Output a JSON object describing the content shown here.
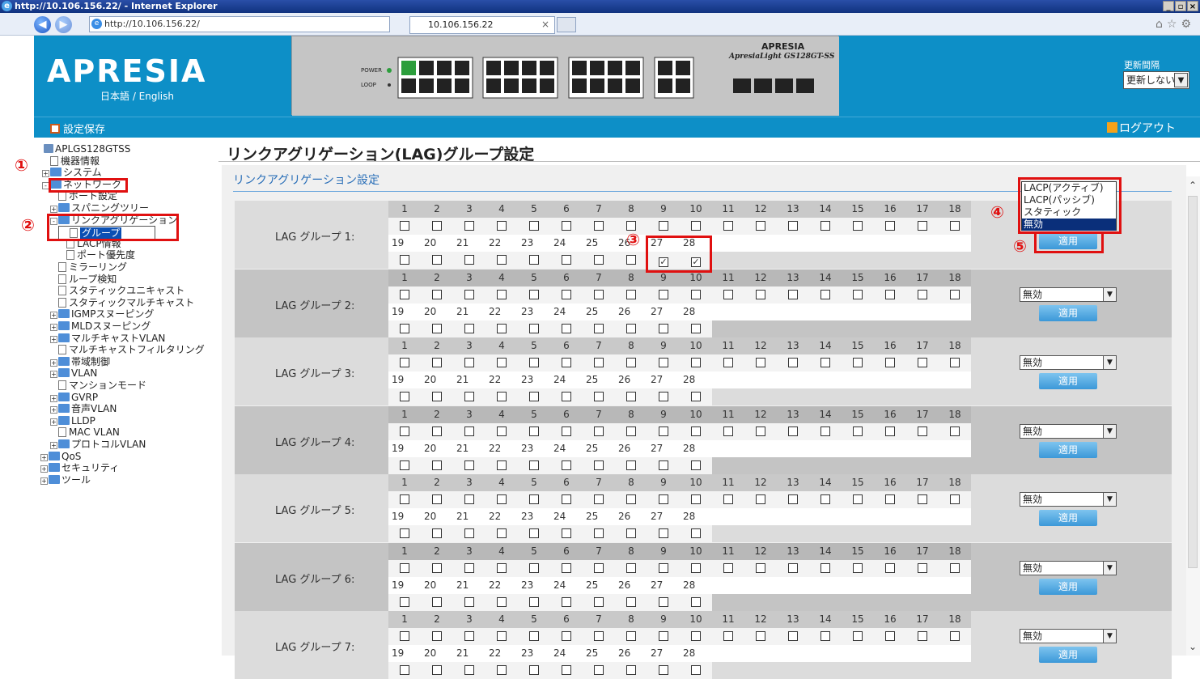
{
  "browser": {
    "title": "http://10.106.156.22/ - Internet Explorer",
    "address": "http://10.106.156.22/",
    "tab": "10.106.156.22"
  },
  "header": {
    "logo": "APRESIA",
    "lang": "日本語 / English",
    "device_model": "ApresiaLight GS128GT-SS",
    "device_brand": "APRESIA",
    "refresh_label": "更新間隔",
    "refresh_value": "更新しない"
  },
  "subbar": {
    "save": "設定保存",
    "logout": "ログアウト"
  },
  "tree": [
    {
      "label": "APLGS128GTSS",
      "indent": 0,
      "kind": "root"
    },
    {
      "label": "機器情報",
      "indent": 1,
      "kind": "file"
    },
    {
      "label": "システム",
      "indent": 1,
      "kind": "folder",
      "pm": "+"
    },
    {
      "label": "ネットワーク",
      "indent": 1,
      "kind": "folder",
      "pm": "-"
    },
    {
      "label": "ポート設定",
      "indent": 2,
      "kind": "file"
    },
    {
      "label": "スパニングツリー",
      "indent": 2,
      "kind": "folder",
      "pm": "+"
    },
    {
      "label": "リンクアグリゲーション",
      "indent": 2,
      "kind": "folder",
      "pm": "-"
    },
    {
      "label": "グループ",
      "indent": 3,
      "kind": "file",
      "selected": true
    },
    {
      "label": "LACP情報",
      "indent": 3,
      "kind": "file"
    },
    {
      "label": "ポート優先度",
      "indent": 3,
      "kind": "file"
    },
    {
      "label": "ミラーリング",
      "indent": 2,
      "kind": "file"
    },
    {
      "label": "ループ検知",
      "indent": 2,
      "kind": "file"
    },
    {
      "label": "スタティックユニキャスト",
      "indent": 2,
      "kind": "file"
    },
    {
      "label": "スタティックマルチキャスト",
      "indent": 2,
      "kind": "file"
    },
    {
      "label": "IGMPスヌーピング",
      "indent": 2,
      "kind": "folder",
      "pm": "+"
    },
    {
      "label": "MLDスヌーピング",
      "indent": 2,
      "kind": "folder",
      "pm": "+"
    },
    {
      "label": "マルチキャストVLAN",
      "indent": 2,
      "kind": "folder",
      "pm": "+"
    },
    {
      "label": "マルチキャストフィルタリング",
      "indent": 2,
      "kind": "file"
    },
    {
      "label": "帯域制御",
      "indent": 2,
      "kind": "folder",
      "pm": "+"
    },
    {
      "label": "VLAN",
      "indent": 2,
      "kind": "folder",
      "pm": "+"
    },
    {
      "label": "マンションモード",
      "indent": 2,
      "kind": "file"
    },
    {
      "label": "GVRP",
      "indent": 2,
      "kind": "folder",
      "pm": "+"
    },
    {
      "label": "音声VLAN",
      "indent": 2,
      "kind": "folder",
      "pm": "+"
    },
    {
      "label": "LLDP",
      "indent": 2,
      "kind": "folder",
      "pm": "+"
    },
    {
      "label": "MAC VLAN",
      "indent": 2,
      "kind": "file"
    },
    {
      "label": "プロトコルVLAN",
      "indent": 2,
      "kind": "folder",
      "pm": "+"
    },
    {
      "label": "QoS",
      "indent": 0,
      "kind": "folder",
      "pm": "+"
    },
    {
      "label": "セキュリティ",
      "indent": 0,
      "kind": "folder",
      "pm": "+"
    },
    {
      "label": "ツール",
      "indent": 0,
      "kind": "folder",
      "pm": "+"
    }
  ],
  "main": {
    "title": "リンクアグリゲーション(LAG)グループ設定",
    "section": "リンクアグリゲーション設定",
    "ports_row1": [
      "1",
      "2",
      "3",
      "4",
      "5",
      "6",
      "7",
      "8",
      "9",
      "10",
      "11",
      "12",
      "13",
      "14",
      "15",
      "16",
      "17",
      "18"
    ],
    "ports_row2": [
      "19",
      "20",
      "21",
      "22",
      "23",
      "24",
      "25",
      "26",
      "27",
      "28"
    ],
    "apply_label": "適用",
    "groups": [
      {
        "label": "LAG グループ 1:",
        "mode": "無効",
        "checked": [
          "27",
          "28"
        ]
      },
      {
        "label": "LAG グループ 2:",
        "mode": "無効",
        "checked": []
      },
      {
        "label": "LAG グループ 3:",
        "mode": "無効",
        "checked": []
      },
      {
        "label": "LAG グループ 4:",
        "mode": "無効",
        "checked": []
      },
      {
        "label": "LAG グループ 5:",
        "mode": "無効",
        "checked": []
      },
      {
        "label": "LAG グループ 6:",
        "mode": "無効",
        "checked": []
      },
      {
        "label": "LAG グループ 7:",
        "mode": "無効",
        "checked": []
      }
    ],
    "mode_options": [
      "LACP(アクティブ)",
      "LACP(パッシブ)",
      "スタティック",
      "無効"
    ],
    "mode_highlighted": "無効"
  },
  "annotations": [
    "①",
    "②",
    "③",
    "④",
    "⑤"
  ],
  "colors": {
    "header": "#0d8fc7",
    "annotation": "#e01010",
    "apply": "#3b98d8"
  }
}
